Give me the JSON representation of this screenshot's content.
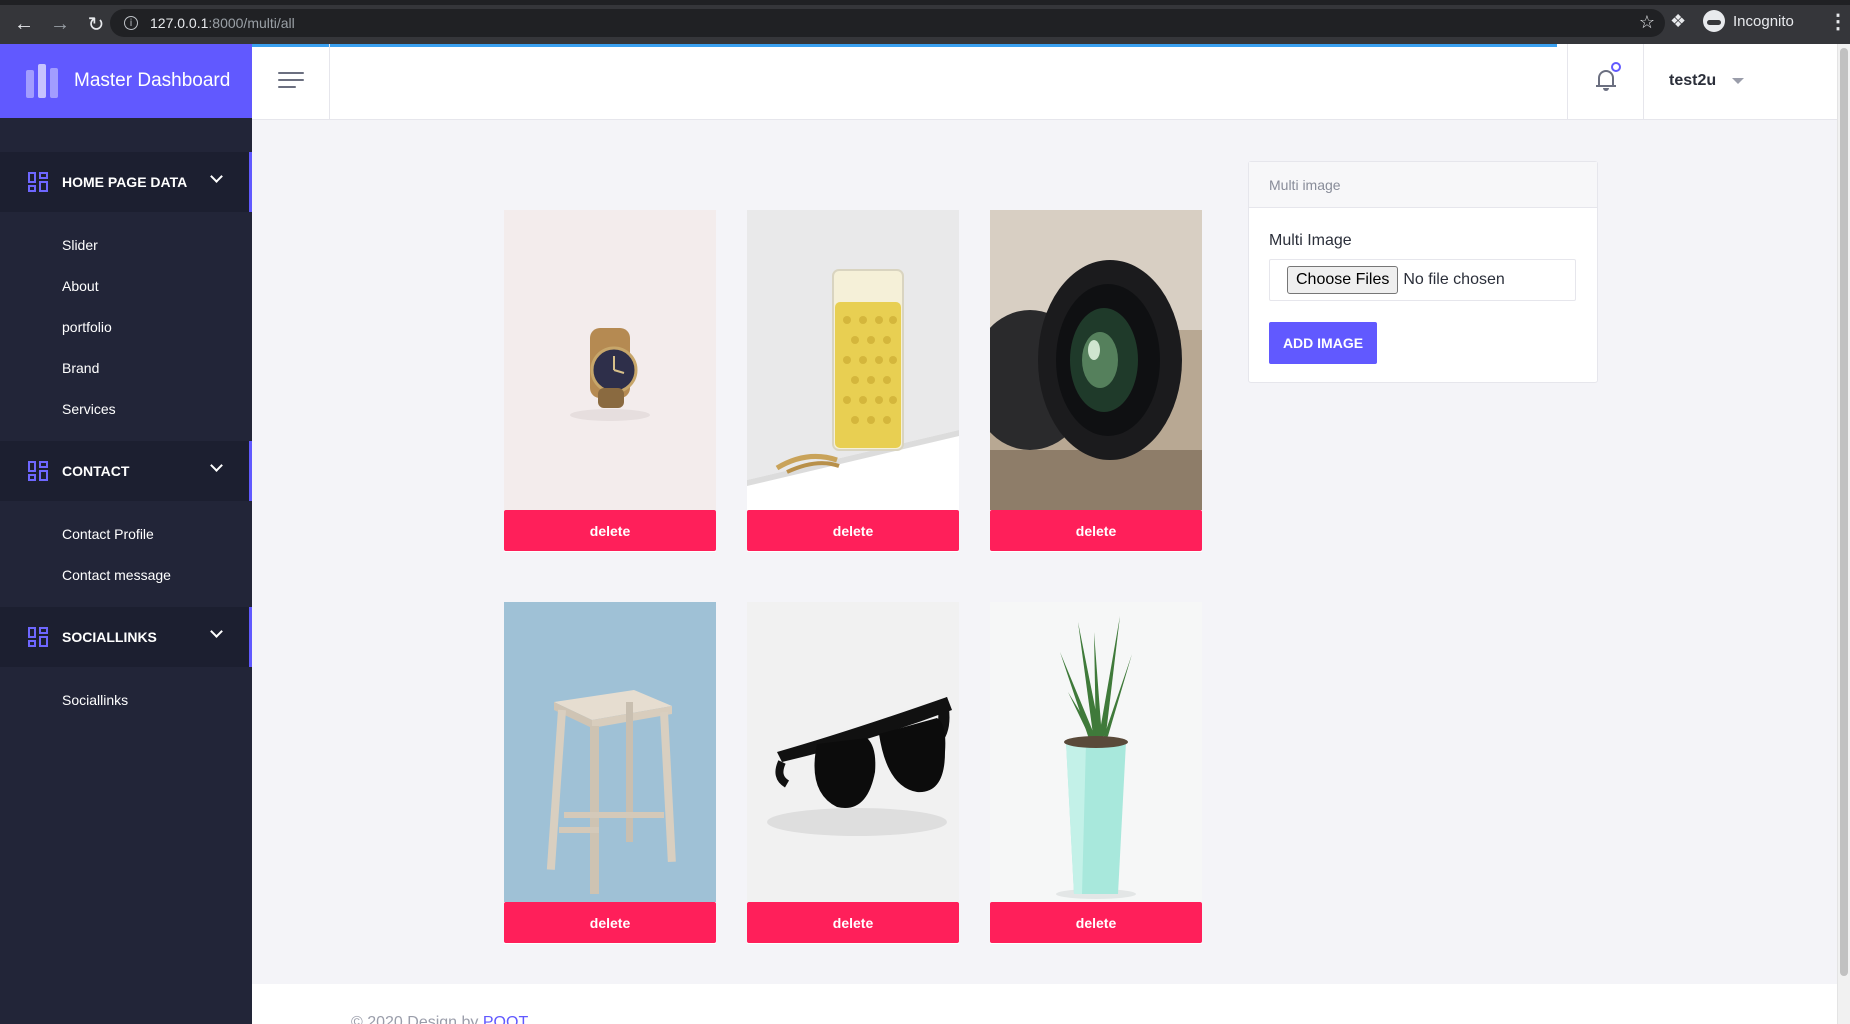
{
  "browser": {
    "url_host": "127.0.0.1",
    "url_path": ":8000/multi/all",
    "incognito_label": "Incognito",
    "icons": [
      "back-arrow-icon",
      "forward-arrow-icon",
      "reload-icon",
      "info-icon",
      "star-icon",
      "puzzle-icon",
      "incognito-icon",
      "kebab-icon"
    ]
  },
  "sidebar": {
    "brand_title": "Master Dashboard",
    "sections": [
      {
        "label": "HOME PAGE DATA",
        "items": [
          "Slider",
          "About",
          "portfolio",
          "Brand",
          "Services"
        ]
      },
      {
        "label": "CONTACT",
        "items": [
          "Contact Profile",
          "Contact message"
        ]
      },
      {
        "label": "SOCIALLINKS",
        "items": [
          "Sociallinks"
        ]
      }
    ]
  },
  "header": {
    "username": "test2u"
  },
  "gallery": {
    "delete_label": "delete",
    "images": [
      "watch",
      "glass of beer",
      "camera lens",
      "wooden stool",
      "sunglasses",
      "potted succulent"
    ]
  },
  "upload": {
    "card_title": "Multi image",
    "field_label": "Multi Image",
    "choose_label": "Choose Files",
    "no_file_label": "No file chosen",
    "submit_label": "ADD IMAGE"
  },
  "footer": {
    "prefix": "© 2020 Design by ",
    "link": "POOT"
  },
  "colors": {
    "accent": "#6159ff",
    "sidebar_bg": "#222538",
    "delete_button": "#ff1f5a"
  }
}
